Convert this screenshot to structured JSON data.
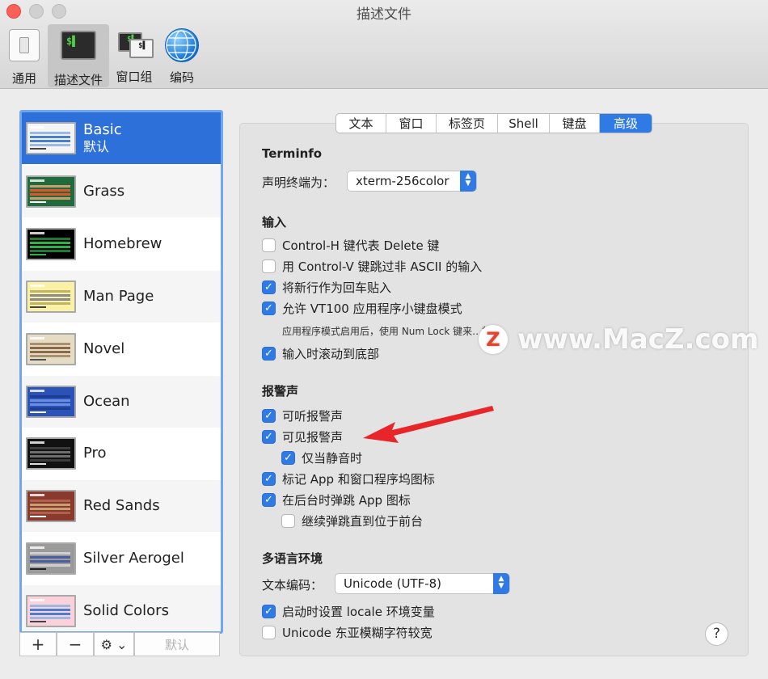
{
  "window": {
    "title": "描述文件"
  },
  "toolbar": {
    "items": [
      {
        "label": "通用",
        "icon": "general-switch-icon"
      },
      {
        "label": "描述文件",
        "icon": "terminal-profile-icon",
        "icon_text": "$▌"
      },
      {
        "label": "窗口组",
        "icon": "window-group-icon",
        "icon_text": "$▌"
      },
      {
        "label": "编码",
        "icon": "globe-icon"
      }
    ],
    "selected": "描述文件"
  },
  "profiles": {
    "items": [
      {
        "name": "Basic",
        "sub": "默认",
        "colors": {
          "bg": "#f4f4f4",
          "bar": "#4a7fd0",
          "bar2": "#9bb9e8",
          "ln": "#444"
        }
      },
      {
        "name": "Grass",
        "colors": {
          "bg": "#1f6b3d",
          "bar": "#e0542c",
          "bar2": "#c8a070",
          "ln": "#fff"
        }
      },
      {
        "name": "Homebrew",
        "colors": {
          "bg": "#000000",
          "bar": "#2bb34a",
          "bar2": "#1f7a33",
          "ln": "#2bb34a"
        }
      },
      {
        "name": "Man Page",
        "colors": {
          "bg": "#fbf1a6",
          "bar": "#8a8a8a",
          "bar2": "#bfb56a",
          "ln": "#444"
        }
      },
      {
        "name": "Novel",
        "colors": {
          "bg": "#e6dcc4",
          "bar": "#8a6a4a",
          "bar2": "#a89070",
          "ln": "#555"
        }
      },
      {
        "name": "Ocean",
        "colors": {
          "bg": "#2a52b8",
          "bar": "#6a8de0",
          "bar2": "#1e3d8e",
          "ln": "#fff"
        }
      },
      {
        "name": "Pro",
        "colors": {
          "bg": "#111111",
          "bar": "#6e6e6e",
          "bar2": "#3c3c3c",
          "ln": "#ddd"
        }
      },
      {
        "name": "Red Sands",
        "colors": {
          "bg": "#8a3a2c",
          "bar": "#c8a070",
          "bar2": "#b06050",
          "ln": "#fff"
        }
      },
      {
        "name": "Silver Aerogel",
        "colors": {
          "bg": "#9a9a9a",
          "bar": "#4a5fa0",
          "bar2": "#cfcfcf",
          "ln": "#222"
        }
      },
      {
        "name": "Solid Colors",
        "colors": {
          "bg": "#fbd2dc",
          "bar": "#4a7fd0",
          "bar2": "#a0b8e0",
          "ln": "#444"
        }
      }
    ],
    "selected": "Basic",
    "controls": {
      "add": "+",
      "remove": "−",
      "action": "⚙︎ ⌄",
      "default_label": "默认"
    }
  },
  "tabs": {
    "items": [
      "文本",
      "窗口",
      "标签页",
      "Shell",
      "键盘",
      "高级"
    ],
    "active": "高级"
  },
  "advanced": {
    "terminfo": {
      "title": "Terminfo",
      "declare_label": "声明终端为：",
      "declare_value": "xterm-256color"
    },
    "input": {
      "title": "输入",
      "options": [
        {
          "label": "Control-H 键代表 Delete 键",
          "checked": false
        },
        {
          "label": "用 Control-V 键跳过非 ASCII 的输入",
          "checked": false
        },
        {
          "label": "将新行作为回车贴入",
          "checked": true
        },
        {
          "label": "允许 VT100 应用程序小键盘模式",
          "checked": true
        },
        {
          "label": "输入时滚动到底部",
          "checked": true
        }
      ],
      "note": "应用程序模式启用后，使用 Num Lock 键来…数字。"
    },
    "bell": {
      "title": "报警声",
      "options": [
        {
          "label": "可听报警声",
          "checked": true
        },
        {
          "label": "可见报警声",
          "checked": true
        },
        {
          "label": "仅当静音时",
          "checked": true
        },
        {
          "label": "标记 App 和窗口程序坞图标",
          "checked": true
        },
        {
          "label": "在后台时弹跳 App 图标",
          "checked": true
        },
        {
          "label": "继续弹跳直到位于前台",
          "checked": false
        }
      ]
    },
    "locale": {
      "title": "多语言环境",
      "encoding_label": "文本编码：",
      "encoding_value": "Unicode (UTF-8)",
      "options": [
        {
          "label": "启动时设置 locale 环境变量",
          "checked": true
        },
        {
          "label": "Unicode 东亚模糊字符较宽",
          "checked": false
        }
      ]
    },
    "help": "?"
  },
  "watermark": {
    "logo": "Z",
    "text": "www.MacZ.com"
  },
  "colors": {
    "accent": "#2f7ae5",
    "selection": "#2e70da",
    "annotation_arrow": "#e8262a"
  }
}
